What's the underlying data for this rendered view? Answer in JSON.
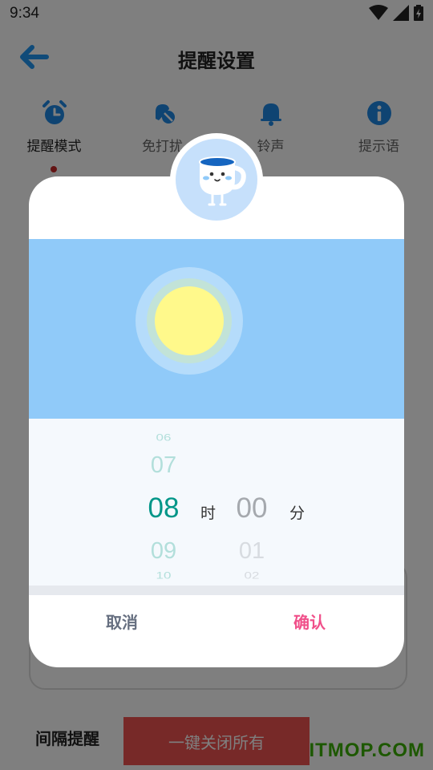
{
  "status_bar": {
    "time": "9:34"
  },
  "header": {
    "title": "提醒设置"
  },
  "tabs": [
    {
      "label": "提醒模式",
      "icon": "alarm-clock-icon",
      "active": true
    },
    {
      "label": "免打扰",
      "icon": "bell-off-icon",
      "active": false
    },
    {
      "label": "铃声",
      "icon": "bell-icon",
      "active": false
    },
    {
      "label": "提示语",
      "icon": "info-icon",
      "active": false
    }
  ],
  "interval": {
    "label": "间隔提醒"
  },
  "close_all": {
    "label": "一键关闭所有"
  },
  "watermark": "ITMOP.COM",
  "dialog": {
    "hour_wheel": {
      "above2": "06",
      "above1": "07",
      "selected": "08",
      "below1": "09",
      "below2": "10"
    },
    "minute_wheel": {
      "selected": "00",
      "below1": "01",
      "below2": "02"
    },
    "hour_unit": "时",
    "minute_unit": "分",
    "cancel_label": "取消",
    "confirm_label": "确认"
  },
  "colors": {
    "accent_teal": "#009688",
    "confirm_pink": "#f0508a",
    "sky_blue": "#90caf9",
    "sun_yellow": "#fff98b",
    "close_all_red": "#ef5350"
  }
}
